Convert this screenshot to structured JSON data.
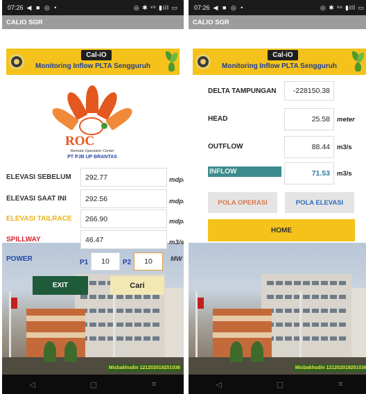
{
  "status": {
    "time": "07:26",
    "left_icons": "◀ ■ ◎ •",
    "right_icons": "◎ ✱ ᵛᵒ ▮ill ▭"
  },
  "app": {
    "window_title": "CALIO SGR",
    "badge": "Cal-iO",
    "banner_title": "Monitoring Inflow PLTA Sengguruh"
  },
  "logo": {
    "word": "ROC",
    "subtitle": "Remote Operation Center",
    "company": "PT PJB UP BRANTAS"
  },
  "left": {
    "fields": [
      {
        "label": "ELEVASI SEBELUM",
        "value": "292.77",
        "unit": "mdpl",
        "label_color": "#333333"
      },
      {
        "label": "ELEVASI SAAT INI",
        "value": "292.56",
        "unit": "mdpl",
        "label_color": "#333333"
      },
      {
        "label": "ELEVASI TAILRACE",
        "value": "266.90",
        "unit": "mdpl",
        "label_color": "#e9b219"
      },
      {
        "label": "SPILLWAY",
        "value": "46.47",
        "unit": "m3/s",
        "label_color": "#d8222a"
      }
    ],
    "power": {
      "label": "POWER",
      "p1_label": "P1",
      "p1_value": "10",
      "p2_label": "P2",
      "p2_value": "10",
      "unit": "MW",
      "label_color": "#2645a4"
    },
    "exit_label": "EXIT",
    "cari_label": "Cari",
    "footer": "Misbakhudin 121202019251036"
  },
  "right": {
    "fields": [
      {
        "label": "DELTA TAMPUNGAN",
        "value": "-228150.38",
        "unit": ""
      },
      {
        "label": "HEAD",
        "value": "25.58",
        "unit": "meter"
      },
      {
        "label": "OUTFLOW",
        "value": "88.44",
        "unit": "m3/s"
      },
      {
        "label": "INFLOW",
        "value": "71.53",
        "unit": "m3/s"
      }
    ],
    "pola_operasi_label": "POLA OPERASI",
    "pola_elevasi_label": "POLA ELEVASI",
    "home_label": "HOME",
    "footer": "Misbakhudin 121202019251036"
  },
  "nav": {
    "back": "◁",
    "home": "▢",
    "menu": "≡"
  },
  "colors": {
    "banner": "#f4c21a",
    "banner_text": "#1f3d99",
    "exit_button": "#1f5a3a",
    "cari_button": "#f3e7b4",
    "pola_operasi": "#d7774b",
    "pola_elevasi": "#2d6db8",
    "home_button": "#f4c21a",
    "inflow_highlight": "#3c8c8e"
  }
}
